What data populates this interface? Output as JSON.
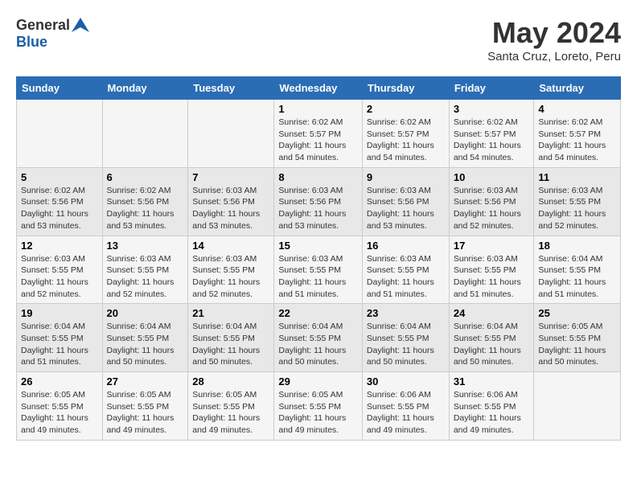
{
  "logo": {
    "line1": "General",
    "line2": "Blue"
  },
  "title": "May 2024",
  "location": "Santa Cruz, Loreto, Peru",
  "days_of_week": [
    "Sunday",
    "Monday",
    "Tuesday",
    "Wednesday",
    "Thursday",
    "Friday",
    "Saturday"
  ],
  "weeks": [
    [
      {
        "day": "",
        "info": ""
      },
      {
        "day": "",
        "info": ""
      },
      {
        "day": "",
        "info": ""
      },
      {
        "day": "1",
        "info": "Sunrise: 6:02 AM\nSunset: 5:57 PM\nDaylight: 11 hours and 54 minutes."
      },
      {
        "day": "2",
        "info": "Sunrise: 6:02 AM\nSunset: 5:57 PM\nDaylight: 11 hours and 54 minutes."
      },
      {
        "day": "3",
        "info": "Sunrise: 6:02 AM\nSunset: 5:57 PM\nDaylight: 11 hours and 54 minutes."
      },
      {
        "day": "4",
        "info": "Sunrise: 6:02 AM\nSunset: 5:57 PM\nDaylight: 11 hours and 54 minutes."
      }
    ],
    [
      {
        "day": "5",
        "info": "Sunrise: 6:02 AM\nSunset: 5:56 PM\nDaylight: 11 hours and 53 minutes."
      },
      {
        "day": "6",
        "info": "Sunrise: 6:02 AM\nSunset: 5:56 PM\nDaylight: 11 hours and 53 minutes."
      },
      {
        "day": "7",
        "info": "Sunrise: 6:03 AM\nSunset: 5:56 PM\nDaylight: 11 hours and 53 minutes."
      },
      {
        "day": "8",
        "info": "Sunrise: 6:03 AM\nSunset: 5:56 PM\nDaylight: 11 hours and 53 minutes."
      },
      {
        "day": "9",
        "info": "Sunrise: 6:03 AM\nSunset: 5:56 PM\nDaylight: 11 hours and 53 minutes."
      },
      {
        "day": "10",
        "info": "Sunrise: 6:03 AM\nSunset: 5:56 PM\nDaylight: 11 hours and 52 minutes."
      },
      {
        "day": "11",
        "info": "Sunrise: 6:03 AM\nSunset: 5:55 PM\nDaylight: 11 hours and 52 minutes."
      }
    ],
    [
      {
        "day": "12",
        "info": "Sunrise: 6:03 AM\nSunset: 5:55 PM\nDaylight: 11 hours and 52 minutes."
      },
      {
        "day": "13",
        "info": "Sunrise: 6:03 AM\nSunset: 5:55 PM\nDaylight: 11 hours and 52 minutes."
      },
      {
        "day": "14",
        "info": "Sunrise: 6:03 AM\nSunset: 5:55 PM\nDaylight: 11 hours and 52 minutes."
      },
      {
        "day": "15",
        "info": "Sunrise: 6:03 AM\nSunset: 5:55 PM\nDaylight: 11 hours and 51 minutes."
      },
      {
        "day": "16",
        "info": "Sunrise: 6:03 AM\nSunset: 5:55 PM\nDaylight: 11 hours and 51 minutes."
      },
      {
        "day": "17",
        "info": "Sunrise: 6:03 AM\nSunset: 5:55 PM\nDaylight: 11 hours and 51 minutes."
      },
      {
        "day": "18",
        "info": "Sunrise: 6:04 AM\nSunset: 5:55 PM\nDaylight: 11 hours and 51 minutes."
      }
    ],
    [
      {
        "day": "19",
        "info": "Sunrise: 6:04 AM\nSunset: 5:55 PM\nDaylight: 11 hours and 51 minutes."
      },
      {
        "day": "20",
        "info": "Sunrise: 6:04 AM\nSunset: 5:55 PM\nDaylight: 11 hours and 50 minutes."
      },
      {
        "day": "21",
        "info": "Sunrise: 6:04 AM\nSunset: 5:55 PM\nDaylight: 11 hours and 50 minutes."
      },
      {
        "day": "22",
        "info": "Sunrise: 6:04 AM\nSunset: 5:55 PM\nDaylight: 11 hours and 50 minutes."
      },
      {
        "day": "23",
        "info": "Sunrise: 6:04 AM\nSunset: 5:55 PM\nDaylight: 11 hours and 50 minutes."
      },
      {
        "day": "24",
        "info": "Sunrise: 6:04 AM\nSunset: 5:55 PM\nDaylight: 11 hours and 50 minutes."
      },
      {
        "day": "25",
        "info": "Sunrise: 6:05 AM\nSunset: 5:55 PM\nDaylight: 11 hours and 50 minutes."
      }
    ],
    [
      {
        "day": "26",
        "info": "Sunrise: 6:05 AM\nSunset: 5:55 PM\nDaylight: 11 hours and 49 minutes."
      },
      {
        "day": "27",
        "info": "Sunrise: 6:05 AM\nSunset: 5:55 PM\nDaylight: 11 hours and 49 minutes."
      },
      {
        "day": "28",
        "info": "Sunrise: 6:05 AM\nSunset: 5:55 PM\nDaylight: 11 hours and 49 minutes."
      },
      {
        "day": "29",
        "info": "Sunrise: 6:05 AM\nSunset: 5:55 PM\nDaylight: 11 hours and 49 minutes."
      },
      {
        "day": "30",
        "info": "Sunrise: 6:06 AM\nSunset: 5:55 PM\nDaylight: 11 hours and 49 minutes."
      },
      {
        "day": "31",
        "info": "Sunrise: 6:06 AM\nSunset: 5:55 PM\nDaylight: 11 hours and 49 minutes."
      },
      {
        "day": "",
        "info": ""
      }
    ]
  ]
}
